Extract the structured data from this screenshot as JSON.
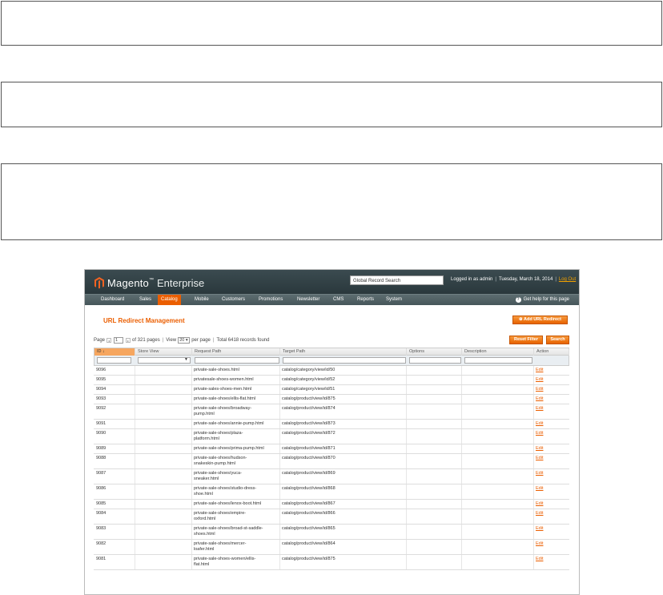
{
  "app": {
    "brand": "Magento",
    "brand_suffix": "Enterprise",
    "search_placeholder": "Global Record Search",
    "logged_in": "Logged in as admin",
    "date": "Tuesday, March 18, 2014",
    "logout": "Log Out",
    "help": "Get help for this page",
    "accent": "#eb5e00"
  },
  "nav": [
    "Dashboard",
    "Sales",
    "Catalog",
    "Mobile",
    "Customers",
    "Promotions",
    "Newsletter",
    "CMS",
    "Reports",
    "System"
  ],
  "nav_active": "Catalog",
  "page": {
    "title": "URL Redirect Management",
    "add_button": "Add URL Redirect",
    "reset_button": "Reset Filter",
    "search_button": "Search"
  },
  "pager": {
    "page_label": "Page",
    "page": "1",
    "of_pages": "of 321 pages",
    "view_label": "View",
    "per_page": "20",
    "per_page_label": "per page",
    "total": "Total 6418 records found"
  },
  "grid": {
    "columns": [
      "ID",
      "Store View",
      "Request Path",
      "Target Path",
      "Options",
      "Description",
      "Action"
    ],
    "rows": [
      {
        "id": "9096",
        "request": [
          "private-sale-shoes.html"
        ],
        "target": "catalog/category/view/id/50",
        "action": "Edit"
      },
      {
        "id": "9095",
        "request": [
          "privatesale-shoes-women.html"
        ],
        "target": "catalog/category/view/id/52",
        "action": "Edit"
      },
      {
        "id": "9094",
        "request": [
          "private-sales-shoes-men.html"
        ],
        "target": "catalog/category/view/id/51",
        "action": "Edit"
      },
      {
        "id": "9093",
        "request": [
          "private-sale-shoes/ellis-flat.html"
        ],
        "target": "catalog/product/view/id/875",
        "action": "Edit"
      },
      {
        "id": "9092",
        "request": [
          "private-sale-shoes/broadway-",
          "pump.html"
        ],
        "target": "catalog/product/view/id/874",
        "action": "Edit"
      },
      {
        "id": "9091",
        "request": [
          "private-sale-shoes/annie-pump.html"
        ],
        "target": "catalog/product/view/id/873",
        "action": "Edit"
      },
      {
        "id": "9090",
        "request": [
          "private-sale-shoes/plaza-",
          "platform.html"
        ],
        "target": "catalog/product/view/id/872",
        "action": "Edit"
      },
      {
        "id": "9089",
        "request": [
          "private-sale-shoes/prima-pump.html"
        ],
        "target": "catalog/product/view/id/871",
        "action": "Edit"
      },
      {
        "id": "9088",
        "request": [
          "private-sale-shoes/hudson-",
          "snakeskin-pump.html"
        ],
        "target": "catalog/product/view/id/870",
        "action": "Edit"
      },
      {
        "id": "9087",
        "request": [
          "private-sale-shoes/yuca-",
          "sneaker.html"
        ],
        "target": "catalog/product/view/id/869",
        "action": "Edit"
      },
      {
        "id": "9086",
        "request": [
          "private-sale-shoes/studio-dress-",
          "shoe.html"
        ],
        "target": "catalog/product/view/id/868",
        "action": "Edit"
      },
      {
        "id": "9085",
        "request": [
          "private-sale-shoes/lenox-boot.html"
        ],
        "target": "catalog/product/view/id/867",
        "action": "Edit"
      },
      {
        "id": "9084",
        "request": [
          "private-sale-shoes/empire-",
          "oxford.html"
        ],
        "target": "catalog/product/view/id/866",
        "action": "Edit"
      },
      {
        "id": "9083",
        "request": [
          "private-sale-shoes/broad-st-saddle-",
          "shoes.html"
        ],
        "target": "catalog/product/view/id/865",
        "action": "Edit"
      },
      {
        "id": "9082",
        "request": [
          "private-sale-shoes/mercer-",
          "loafer.html"
        ],
        "target": "catalog/product/view/id/864",
        "action": "Edit"
      },
      {
        "id": "9081",
        "request": [
          "private-sale-shoes-women/ellis-",
          "flat.html"
        ],
        "target": "catalog/product/view/id/875",
        "action": "Edit"
      }
    ]
  }
}
